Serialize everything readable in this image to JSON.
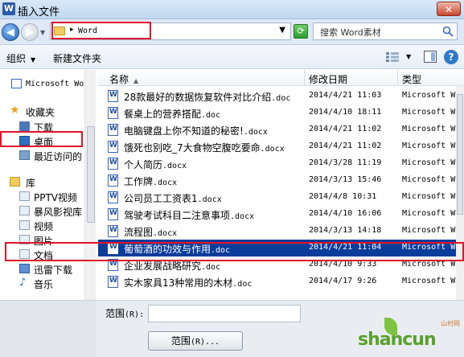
{
  "window": {
    "title": "插入文件"
  },
  "address": {
    "path_segment": "Word"
  },
  "search": {
    "placeholder": "搜索 Word素材"
  },
  "toolbar": {
    "organize": "组织",
    "new_folder": "新建文件夹"
  },
  "nav": {
    "items": [
      {
        "label": "Microsoft Word",
        "mono": true,
        "icon": "word-doc-icon"
      },
      {
        "label": "收藏夹",
        "icon": "star-icon"
      },
      {
        "label": "下载",
        "icon": "download-folder-icon"
      },
      {
        "label": "桌面",
        "icon": "desktop-icon"
      },
      {
        "label": "最近访问的",
        "icon": "recent-icon"
      },
      {
        "label": "库",
        "icon": "library-icon"
      },
      {
        "label": "PPTV视频",
        "icon": "video-folder-icon"
      },
      {
        "label": "暴风影视库",
        "icon": "video-folder-icon"
      },
      {
        "label": "视频",
        "icon": "video-folder-icon"
      },
      {
        "label": "图片",
        "icon": "picture-folder-icon"
      },
      {
        "label": "文档",
        "icon": "documents-folder-icon"
      },
      {
        "label": "迅雷下载",
        "icon": "download-folder-icon"
      },
      {
        "label": "音乐",
        "icon": "music-icon"
      }
    ]
  },
  "columns": {
    "name": "名称",
    "modified": "修改日期",
    "type": "类型"
  },
  "files": [
    {
      "name": "28款最好的数据恢复软件对比介绍",
      "ext": ".doc",
      "date": "2014/4/21 11:03",
      "type": "Microsoft Word"
    },
    {
      "name": "餐桌上的营养搭配",
      "ext": ".doc",
      "date": "2014/4/10 18:11",
      "type": "Microsoft Word"
    },
    {
      "name": "电脑键盘上你不知道的秘密!",
      "ext": ".docx",
      "date": "2014/4/21 11:02",
      "type": "Microsoft Word"
    },
    {
      "name": "饿死也别吃_7大食物空腹吃要命",
      "ext": ".docx",
      "date": "2014/4/21 11:02",
      "type": "Microsoft Word"
    },
    {
      "name": "个人简历",
      "ext": ".docx",
      "date": "2014/3/28 11:19",
      "type": "Microsoft Word"
    },
    {
      "name": "工作牌",
      "ext": ".docx",
      "date": "2014/3/13 15:46",
      "type": "Microsoft Word"
    },
    {
      "name": "公司员工工资表1",
      "ext": ".docx",
      "date": "2014/4/8 10:31",
      "type": "Microsoft Word"
    },
    {
      "name": "驾驶考试科目二注意事项",
      "ext": ".docx",
      "date": "2014/4/10 16:06",
      "type": "Microsoft Word"
    },
    {
      "name": "流程图",
      "ext": ".docx",
      "date": "2014/3/13 14:18",
      "type": "Microsoft Word"
    },
    {
      "name": "葡萄酒的功效与作用",
      "ext": ".doc",
      "date": "2014/4/21 11:04",
      "type": "Microsoft Word",
      "selected": true
    },
    {
      "name": "企业发展战略研究",
      "ext": ".doc",
      "date": "2014/4/10 9:33",
      "type": "Microsoft Word"
    },
    {
      "name": "实木家具13种常用的木材",
      "ext": ".doc",
      "date": "2014/4/17 9:26",
      "type": "Microsoft Word"
    }
  ],
  "bottom": {
    "range_label": "范围",
    "range_key": "(R):",
    "range_button": "范围",
    "range_button_key": "(R)..."
  },
  "watermark": {
    "text": "shancun",
    "sub": "山村网"
  }
}
